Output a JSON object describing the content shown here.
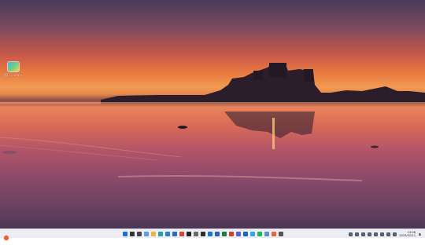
{
  "desktop": {
    "icons": [
      {
        "label": "遥いシルダー",
        "icon": "folder-shortcut-icon"
      }
    ]
  },
  "taskbar": {
    "apps": [
      {
        "icon": "windows-start-icon",
        "color": "#1f6fd6"
      },
      {
        "icon": "search-icon",
        "color": "#333333"
      },
      {
        "icon": "task-view-icon",
        "color": "#444444"
      },
      {
        "icon": "widgets-icon",
        "color": "#5aa0e0"
      },
      {
        "icon": "file-explorer-icon",
        "color": "#e9b73c"
      },
      {
        "icon": "edge-icon",
        "color": "#1fa3a7"
      },
      {
        "icon": "store-icon",
        "color": "#2d7dd2"
      },
      {
        "icon": "mail-icon",
        "color": "#2a6bd0"
      },
      {
        "icon": "chrome-icon",
        "color": "#db4437"
      },
      {
        "icon": "github-icon",
        "color": "#222222"
      },
      {
        "icon": "settings-icon",
        "color": "#6b6b6b"
      },
      {
        "icon": "terminal-icon",
        "color": "#2f2f2f"
      },
      {
        "icon": "vscode-icon",
        "color": "#0e7ad4"
      },
      {
        "icon": "word-icon",
        "color": "#2b5fb8"
      },
      {
        "icon": "excel-icon",
        "color": "#1e7b45"
      },
      {
        "icon": "powerpoint-icon",
        "color": "#d04423"
      },
      {
        "icon": "teams-icon",
        "color": "#5b5fc7"
      },
      {
        "icon": "outlook-icon",
        "color": "#0f6cbd"
      },
      {
        "icon": "photos-icon",
        "color": "#3aa4e6"
      },
      {
        "icon": "spotify-icon",
        "color": "#1db954"
      },
      {
        "icon": "notepad-icon",
        "color": "#5f8fc9"
      },
      {
        "icon": "paint-icon",
        "color": "#e6683a"
      },
      {
        "icon": "calculator-icon",
        "color": "#555555"
      }
    ],
    "tray_icons": [
      "chevron-up-icon",
      "security-icon",
      "keyboard-icon",
      "language-icon",
      "ime-icon",
      "network-icon",
      "volume-icon",
      "battery-icon"
    ],
    "clock": {
      "time": "13:06",
      "date": "2025/02/11"
    }
  }
}
